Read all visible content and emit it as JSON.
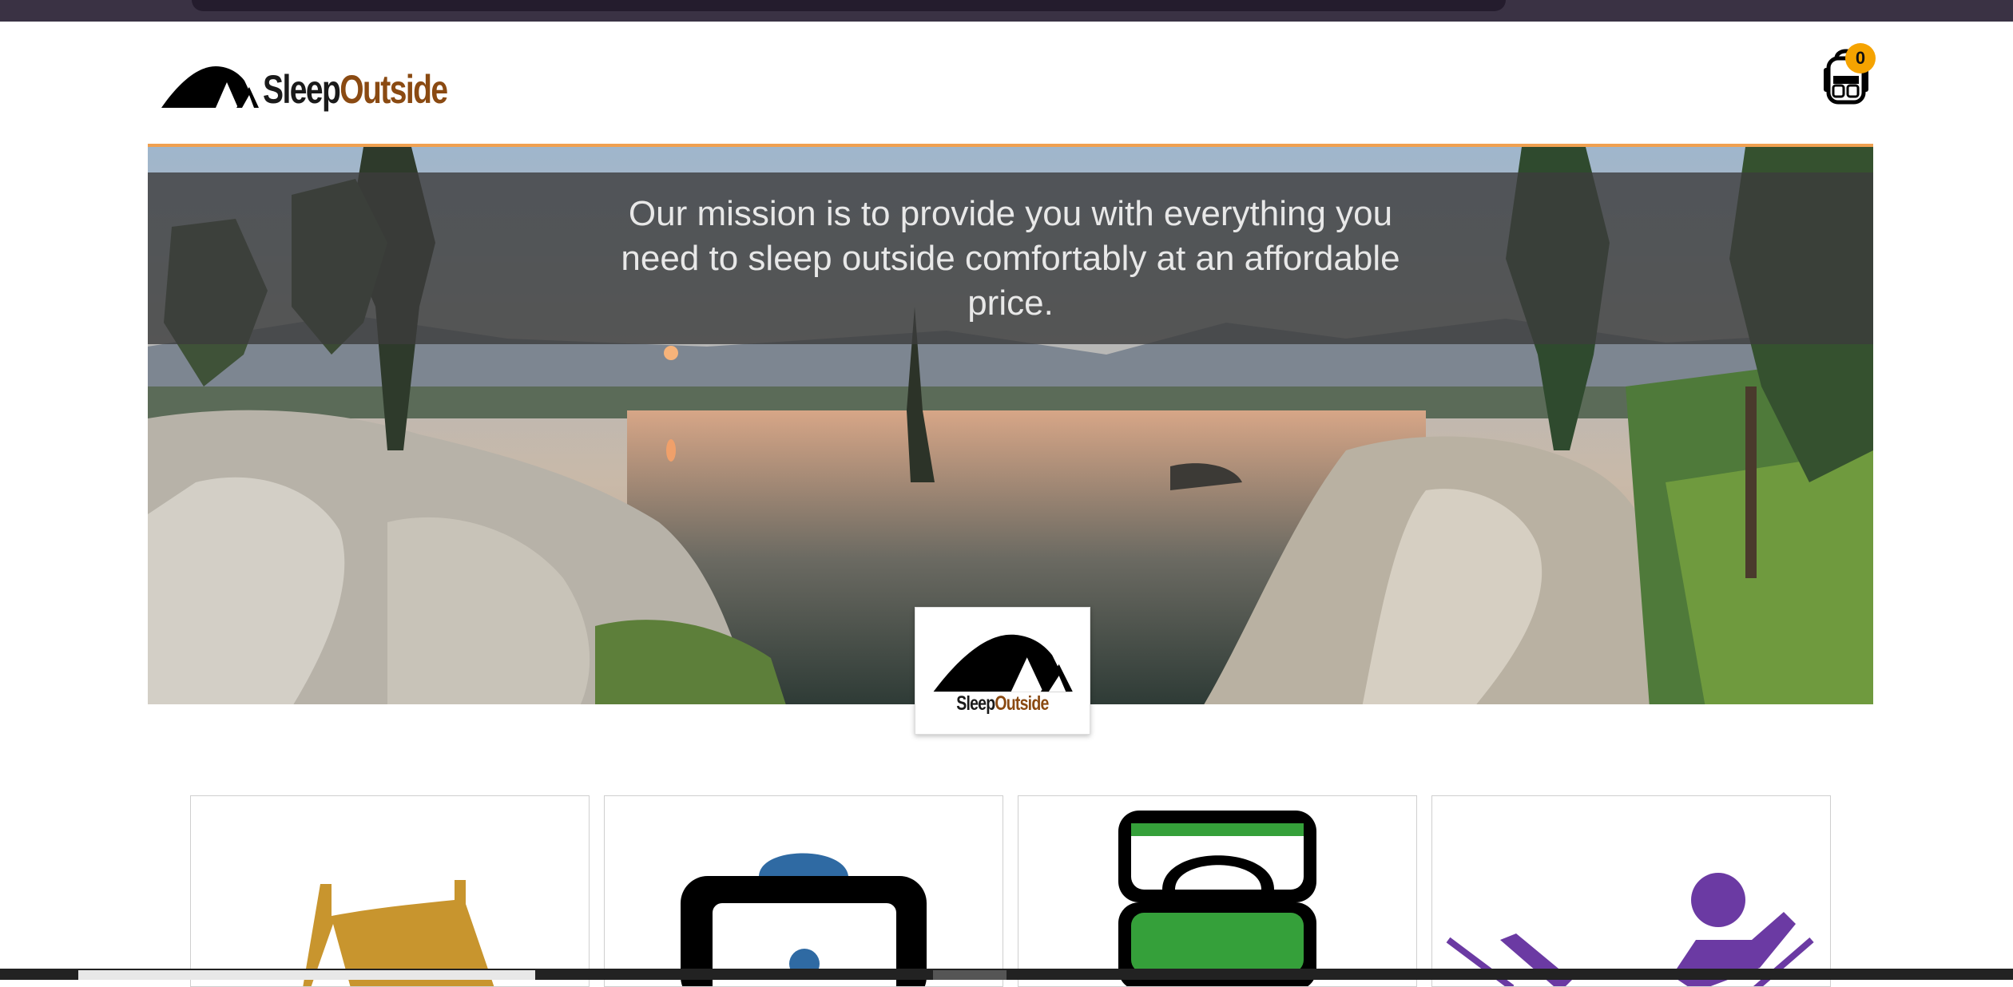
{
  "brand": {
    "name_part1": "Sleep",
    "name_part2": "Outside",
    "colors": {
      "dark": "#1a1a1a",
      "brown": "#8a4a12",
      "accent": "#f5a300",
      "hero_border": "#f0a050"
    }
  },
  "header": {
    "logo_icon": "tent-icon",
    "cart_icon": "backpack-icon",
    "cart_count": "0"
  },
  "hero": {
    "mission": "Our mission is to provide you with everything you need to sleep outside comfortably at an affordable price.",
    "badge_icon": "tent-logo-icon"
  },
  "categories": [
    {
      "icon": "tent-category-icon",
      "color": "#c8952e"
    },
    {
      "icon": "backpack-category-icon",
      "color": "#2f6aa3"
    },
    {
      "icon": "sleeping-bag-category-icon",
      "color": "#35a03a"
    },
    {
      "icon": "hammock-category-icon",
      "color": "#6b3aa3"
    }
  ]
}
